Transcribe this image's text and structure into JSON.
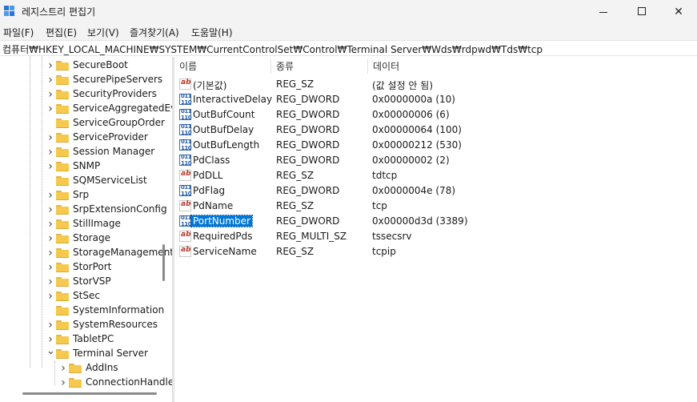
{
  "window": {
    "title": "레지스트리 편집기",
    "minimize_glyph": "—",
    "maximize_glyph": "☐",
    "close_glyph": "✕"
  },
  "menu": [
    "파일(F)",
    "편집(E)",
    "보기(V)",
    "즐겨찾기(A)",
    "도움말(H)"
  ],
  "address": "컴퓨터₩HKEY_LOCAL_MACHINE₩SYSTEM₩CurrentControlSet₩Control₩Terminal Server₩Wds₩rdpwd₩Tds₩tcp",
  "tree": {
    "items": [
      {
        "label": "SecureBoot",
        "chevron": "right"
      },
      {
        "label": "SecurePipeServers",
        "chevron": "right"
      },
      {
        "label": "SecurityProviders",
        "chevron": "right"
      },
      {
        "label": "ServiceAggregatedEvents",
        "chevron": "right"
      },
      {
        "label": "ServiceGroupOrder",
        "chevron": "none"
      },
      {
        "label": "ServiceProvider",
        "chevron": "right"
      },
      {
        "label": "Session Manager",
        "chevron": "right"
      },
      {
        "label": "SNMP",
        "chevron": "right"
      },
      {
        "label": "SQMServiceList",
        "chevron": "none"
      },
      {
        "label": "Srp",
        "chevron": "right"
      },
      {
        "label": "SrpExtensionConfig",
        "chevron": "right"
      },
      {
        "label": "StillImage",
        "chevron": "right"
      },
      {
        "label": "Storage",
        "chevron": "right"
      },
      {
        "label": "StorageManagement",
        "chevron": "right"
      },
      {
        "label": "StorPort",
        "chevron": "right"
      },
      {
        "label": "StorVSP",
        "chevron": "right"
      },
      {
        "label": "StSec",
        "chevron": "right"
      },
      {
        "label": "SystemInformation",
        "chevron": "none"
      },
      {
        "label": "SystemResources",
        "chevron": "right"
      },
      {
        "label": "TabletPC",
        "chevron": "right"
      },
      {
        "label": "Terminal Server",
        "chevron": "down"
      },
      {
        "label": "AddIns",
        "chevron": "right"
      },
      {
        "label": "ConnectionHandler",
        "chevron": "right"
      }
    ]
  },
  "list": {
    "headers": {
      "name": "이름",
      "type": "종류",
      "data": "데이터"
    },
    "rows": [
      {
        "icon": "string-value-icon",
        "name": "(기본값)",
        "type": "REG_SZ",
        "data": "(값 설정 안 됨)"
      },
      {
        "icon": "binary-value-icon",
        "name": "InteractiveDelay",
        "type": "REG_DWORD",
        "data": "0x0000000a (10)"
      },
      {
        "icon": "binary-value-icon",
        "name": "OutBufCount",
        "type": "REG_DWORD",
        "data": "0x00000006 (6)"
      },
      {
        "icon": "binary-value-icon",
        "name": "OutBufDelay",
        "type": "REG_DWORD",
        "data": "0x00000064 (100)"
      },
      {
        "icon": "binary-value-icon",
        "name": "OutBufLength",
        "type": "REG_DWORD",
        "data": "0x00000212 (530)"
      },
      {
        "icon": "binary-value-icon",
        "name": "PdClass",
        "type": "REG_DWORD",
        "data": "0x00000002 (2)"
      },
      {
        "icon": "string-value-icon",
        "name": "PdDLL",
        "type": "REG_SZ",
        "data": "tdtcp"
      },
      {
        "icon": "binary-value-icon",
        "name": "PdFlag",
        "type": "REG_DWORD",
        "data": "0x0000004e (78)"
      },
      {
        "icon": "string-value-icon",
        "name": "PdName",
        "type": "REG_SZ",
        "data": "tcp"
      },
      {
        "icon": "binary-value-icon",
        "name": "PortNumber",
        "type": "REG_DWORD",
        "data": "0x00000d3d (3389)",
        "selected": true
      },
      {
        "icon": "string-value-icon",
        "name": "RequiredPds",
        "type": "REG_MULTI_SZ",
        "data": "tssecsrv"
      },
      {
        "icon": "string-value-icon",
        "name": "ServiceName",
        "type": "REG_SZ",
        "data": "tcpip"
      }
    ]
  },
  "icon_glyphs": {
    "string": "ab",
    "binary": "011\n110"
  },
  "colors": {
    "selection": "#0078d7",
    "folder": "#f5c94e"
  }
}
